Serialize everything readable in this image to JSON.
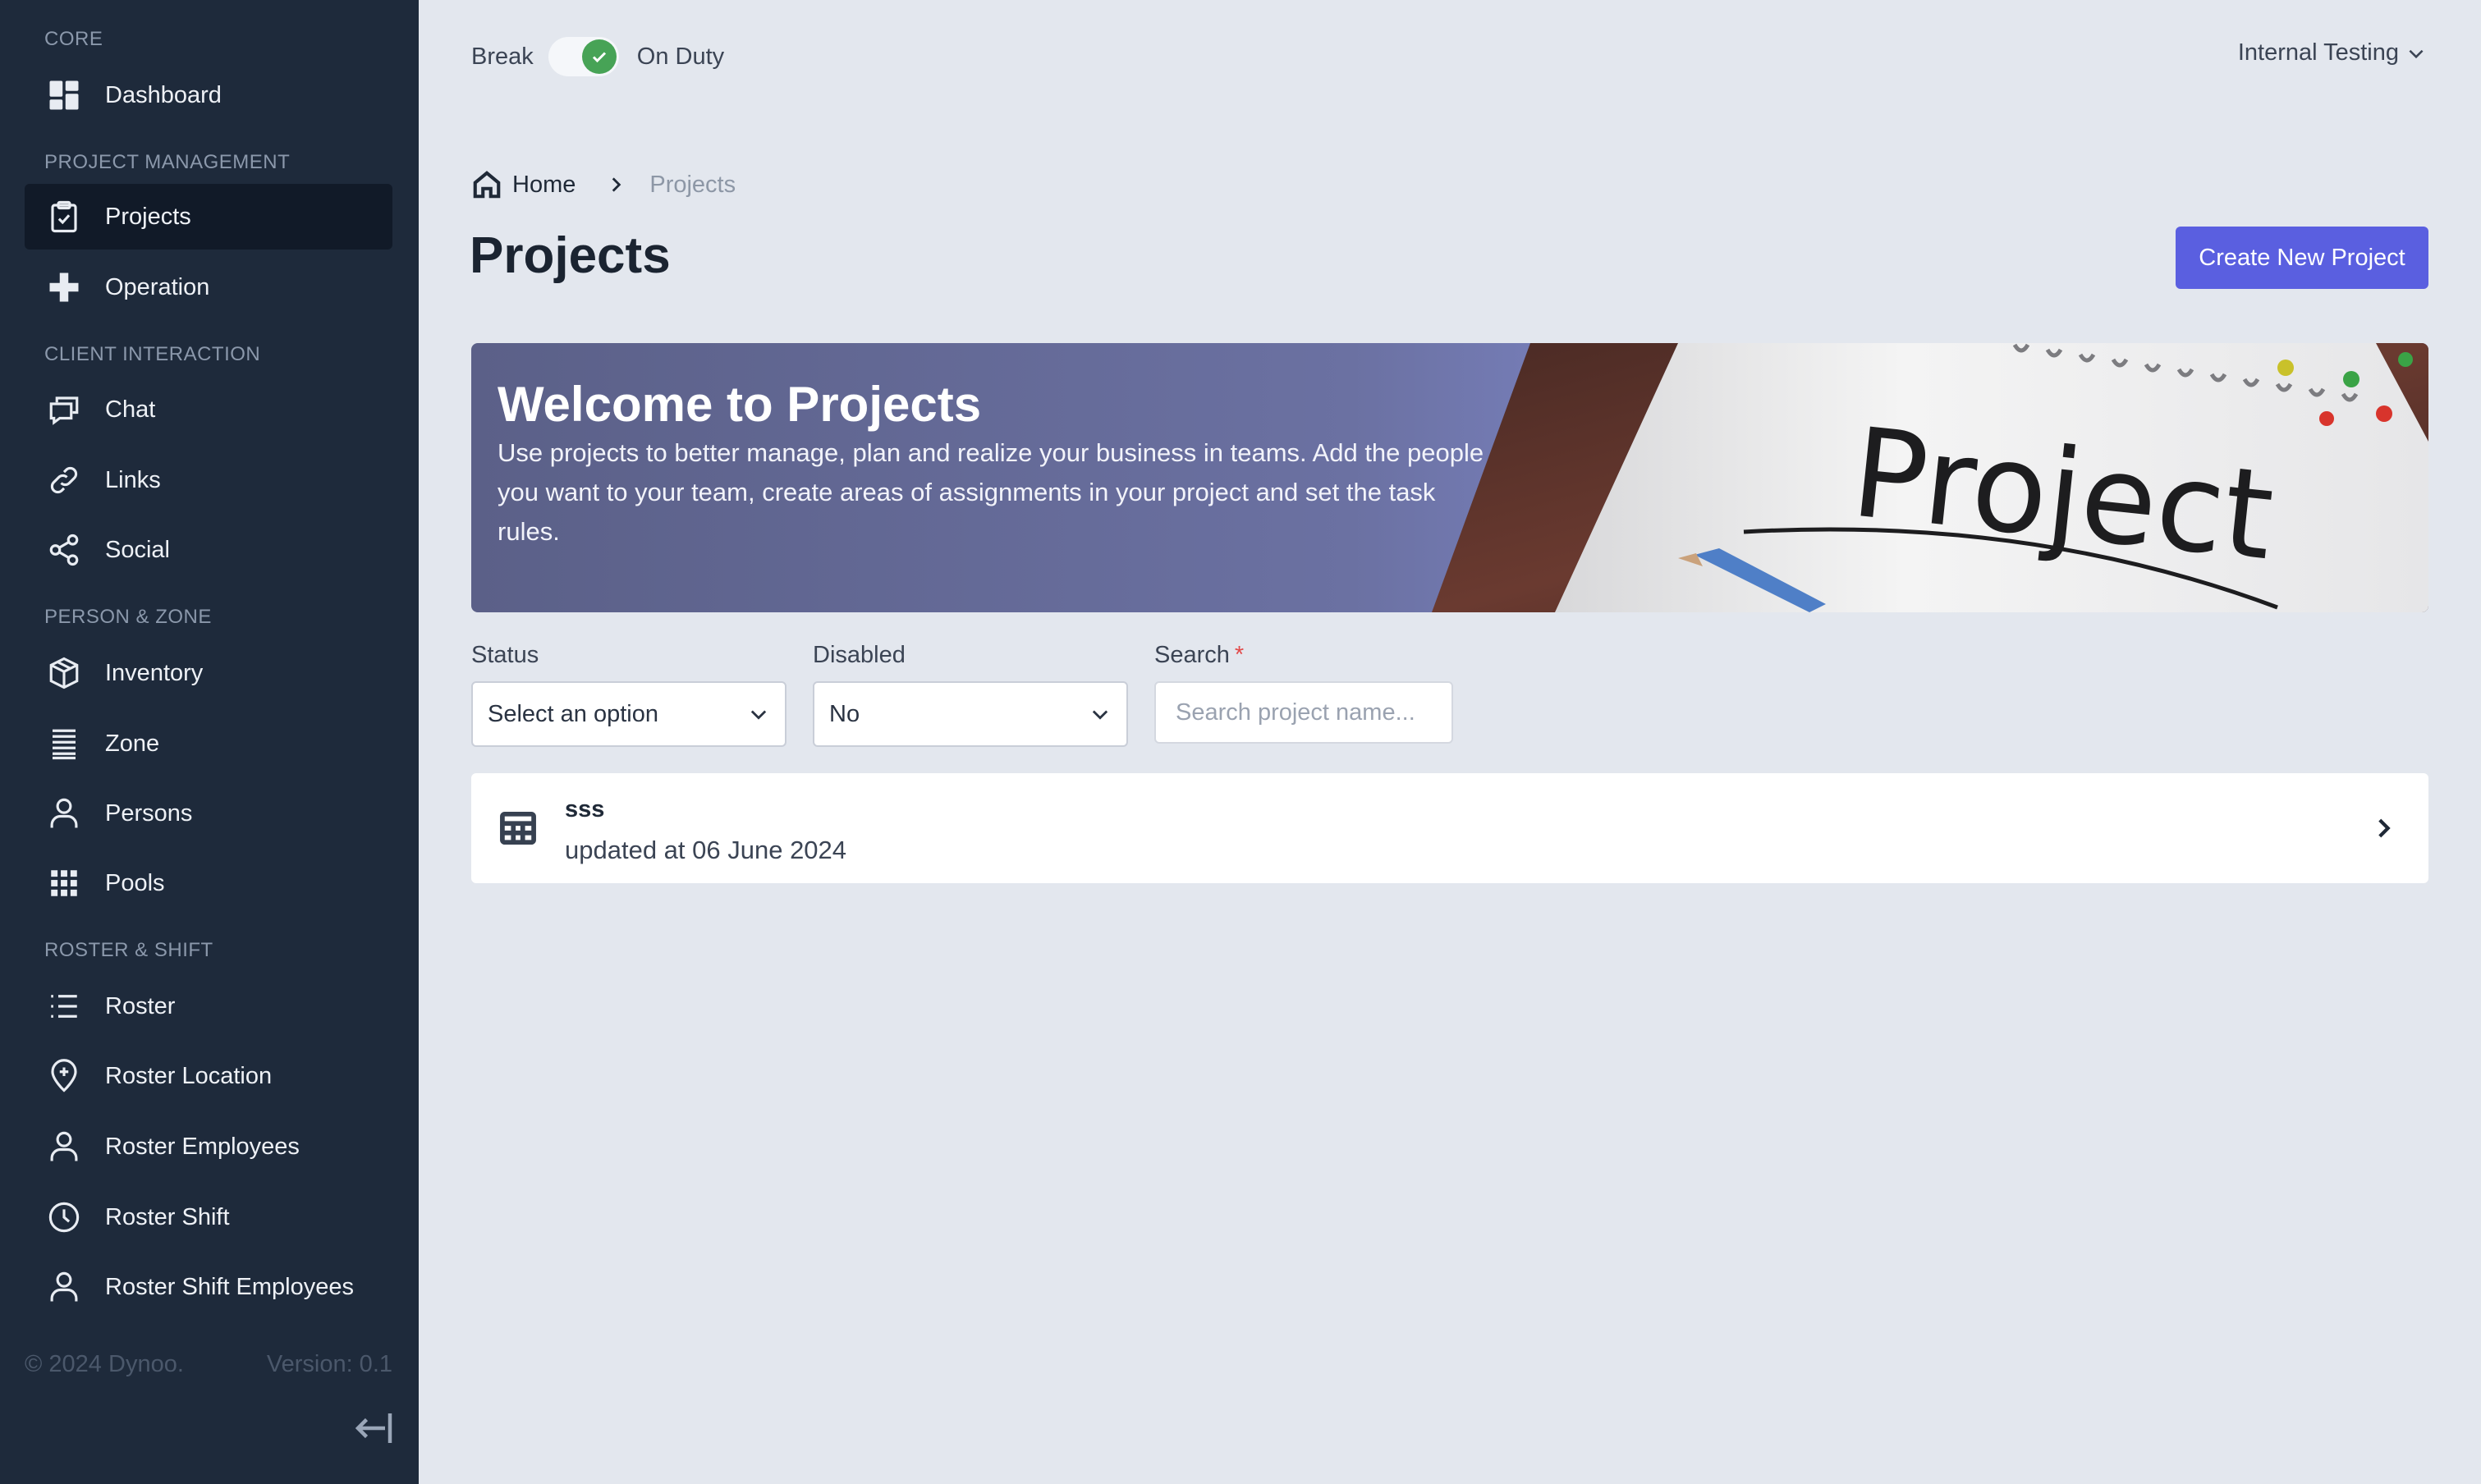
{
  "sidebar": {
    "sections": [
      {
        "title": "CORE"
      },
      {
        "title": "PROJECT MANAGEMENT"
      },
      {
        "title": "CLIENT INTERACTION"
      },
      {
        "title": "PERSON & ZONE"
      },
      {
        "title": "ROSTER & SHIFT"
      }
    ],
    "items": [
      {
        "label": "Dashboard",
        "icon": "dashboard-icon"
      },
      {
        "label": "Projects",
        "icon": "clipboard-check-icon",
        "active": true
      },
      {
        "label": "Operation",
        "icon": "plus-icon"
      },
      {
        "label": "Chat",
        "icon": "chat-icon"
      },
      {
        "label": "Links",
        "icon": "link-icon"
      },
      {
        "label": "Social",
        "icon": "share-icon"
      },
      {
        "label": "Inventory",
        "icon": "box-icon"
      },
      {
        "label": "Zone",
        "icon": "lines-icon"
      },
      {
        "label": "Persons",
        "icon": "person-icon"
      },
      {
        "label": "Pools",
        "icon": "grid-icon"
      },
      {
        "label": "Roster",
        "icon": "list-icon"
      },
      {
        "label": "Roster Location",
        "icon": "map-pin-icon"
      },
      {
        "label": "Roster Employees",
        "icon": "person-icon"
      },
      {
        "label": "Roster Shift",
        "icon": "clock-icon"
      },
      {
        "label": "Roster Shift Employees",
        "icon": "person-icon"
      }
    ],
    "footer": {
      "copyright": "© 2024 Dynoo.",
      "version": "Version: 0.1"
    }
  },
  "topbar": {
    "break_label": "Break",
    "on_duty_label": "On Duty",
    "duty_on": true,
    "workspace": "Internal Testing"
  },
  "breadcrumb": {
    "home": "Home",
    "current": "Projects"
  },
  "page": {
    "title": "Projects",
    "create_button": "Create New Project"
  },
  "banner": {
    "title": "Welcome to Projects",
    "text": "Use projects to better manage, plan and realize your business in teams. Add the people you want to your team, create areas of assignments in your project and set the task rules.",
    "image_text": "Project"
  },
  "filters": {
    "status": {
      "label": "Status",
      "value": "Select an option"
    },
    "disabled": {
      "label": "Disabled",
      "value": "No"
    },
    "search": {
      "label": "Search",
      "required_mark": "*",
      "placeholder": "Search project name..."
    }
  },
  "projects": [
    {
      "name": "sss",
      "updated": "updated at 06 June 2024"
    }
  ],
  "colors": {
    "sidebar_bg": "#1e2a3b",
    "active_item_bg": "#111a28",
    "page_bg": "#e3e7ee",
    "primary": "#5a5fe0",
    "toggle_on": "#47a356"
  }
}
